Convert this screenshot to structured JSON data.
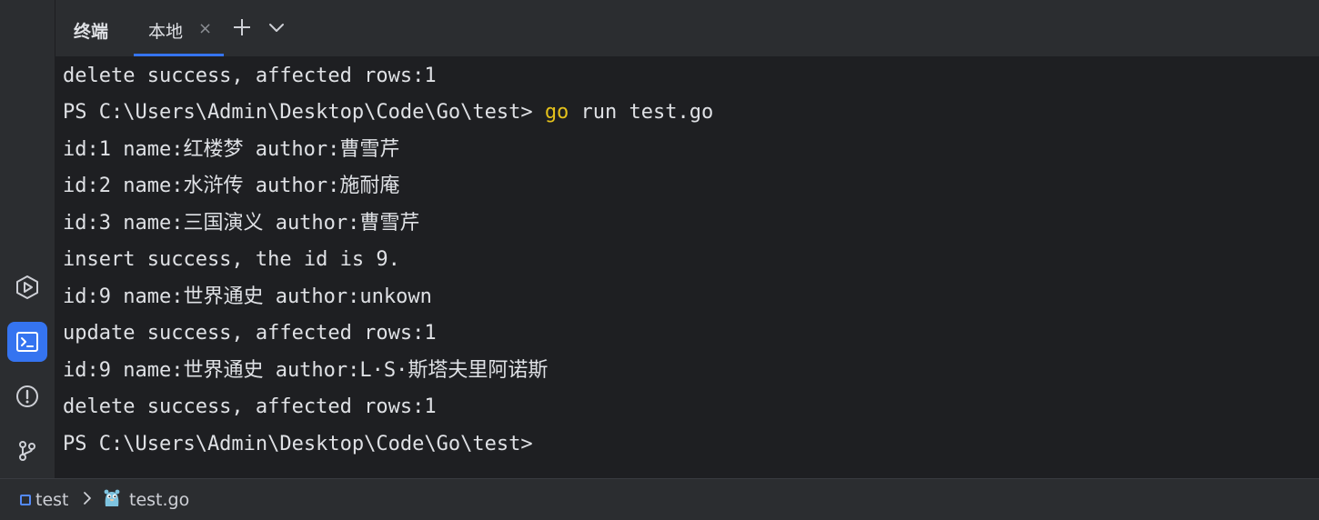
{
  "header": {
    "title": "终端",
    "tabs": [
      {
        "label": "本地",
        "close": "×"
      }
    ],
    "new_tab": "+",
    "dropdown": "⌄"
  },
  "left_toolbar": {
    "items": [
      {
        "icon": "run-icon",
        "active": false
      },
      {
        "icon": "terminal-icon",
        "active": true
      },
      {
        "icon": "problems-icon",
        "active": false
      },
      {
        "icon": "git-branch-icon",
        "active": false
      }
    ]
  },
  "terminal": {
    "lines": [
      {
        "text": "delete success, affected rows:1"
      },
      {
        "prompt": "PS C:\\Users\\Admin\\Desktop\\Code\\Go\\test> ",
        "command": "go",
        "args": " run test.go"
      },
      {
        "text": "id:1 name:红楼梦 author:曹雪芹"
      },
      {
        "text": "id:2 name:水浒传 author:施耐庵"
      },
      {
        "text": "id:3 name:三国演义 author:曹雪芹"
      },
      {
        "text": "insert success, the id is 9."
      },
      {
        "text": "id:9 name:世界通史 author:unkown"
      },
      {
        "text": "update success, affected rows:1"
      },
      {
        "text": "id:9 name:世界通史 author:L·S·斯塔夫里阿诺斯"
      },
      {
        "text": "delete success, affected rows:1"
      },
      {
        "prompt": "PS C:\\Users\\Admin\\Desktop\\Code\\Go\\test>"
      }
    ]
  },
  "statusbar": {
    "breadcrumbs": [
      {
        "label": "test",
        "icon": "module-icon"
      },
      {
        "label": "test.go",
        "icon": "go-file-icon"
      }
    ]
  },
  "colors": {
    "accent": "#3574f0",
    "command_highlight": "#e4c11b",
    "terminal_bg": "#1e1f22",
    "panel_bg": "#2b2d30",
    "text": "#dfe1e5"
  }
}
